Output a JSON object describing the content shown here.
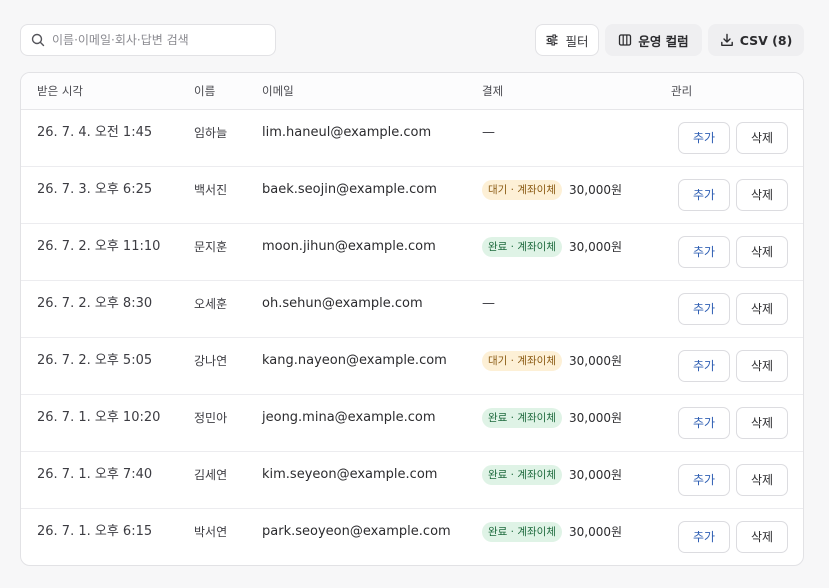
{
  "toolbar": {
    "search_placeholder": "이름·이메일·회사·답변 검색",
    "filter_label": "필터",
    "columns_label": "운영 컬럼",
    "csv_label": "CSV (8)"
  },
  "table": {
    "headers": {
      "time": "받은 시각",
      "name": "이름",
      "email": "이메일",
      "payment": "결제",
      "manage": "관리"
    },
    "rows": [
      {
        "time": "26. 7. 4. 오전 1:45",
        "name": "임하늘",
        "email": "lim.haneul@example.com",
        "status": "",
        "status_type": "",
        "amount": "",
        "dash": "—"
      },
      {
        "time": "26. 7. 3. 오후 6:25",
        "name": "백서진",
        "email": "baek.seojin@example.com",
        "status": "대기 · 계좌이체",
        "status_type": "pending",
        "amount": "30,000원",
        "dash": ""
      },
      {
        "time": "26. 7. 2. 오후 11:10",
        "name": "문지훈",
        "email": "moon.jihun@example.com",
        "status": "완료 · 계좌이체",
        "status_type": "done",
        "amount": "30,000원",
        "dash": ""
      },
      {
        "time": "26. 7. 2. 오후 8:30",
        "name": "오세훈",
        "email": "oh.sehun@example.com",
        "status": "",
        "status_type": "",
        "amount": "",
        "dash": "—"
      },
      {
        "time": "26. 7. 2. 오후 5:05",
        "name": "강나연",
        "email": "kang.nayeon@example.com",
        "status": "대기 · 계좌이체",
        "status_type": "pending",
        "amount": "30,000원",
        "dash": ""
      },
      {
        "time": "26. 7. 1. 오후 10:20",
        "name": "정민아",
        "email": "jeong.mina@example.com",
        "status": "완료 · 계좌이체",
        "status_type": "done",
        "amount": "30,000원",
        "dash": ""
      },
      {
        "time": "26. 7. 1. 오후 7:40",
        "name": "김세연",
        "email": "kim.seyeon@example.com",
        "status": "완료 · 계좌이체",
        "status_type": "done",
        "amount": "30,000원",
        "dash": ""
      },
      {
        "time": "26. 7. 1. 오후 6:15",
        "name": "박서연",
        "email": "park.seoyeon@example.com",
        "status": "완료 · 계좌이체",
        "status_type": "done",
        "amount": "30,000원",
        "dash": ""
      }
    ],
    "add_label": "추가",
    "delete_label": "삭제"
  }
}
